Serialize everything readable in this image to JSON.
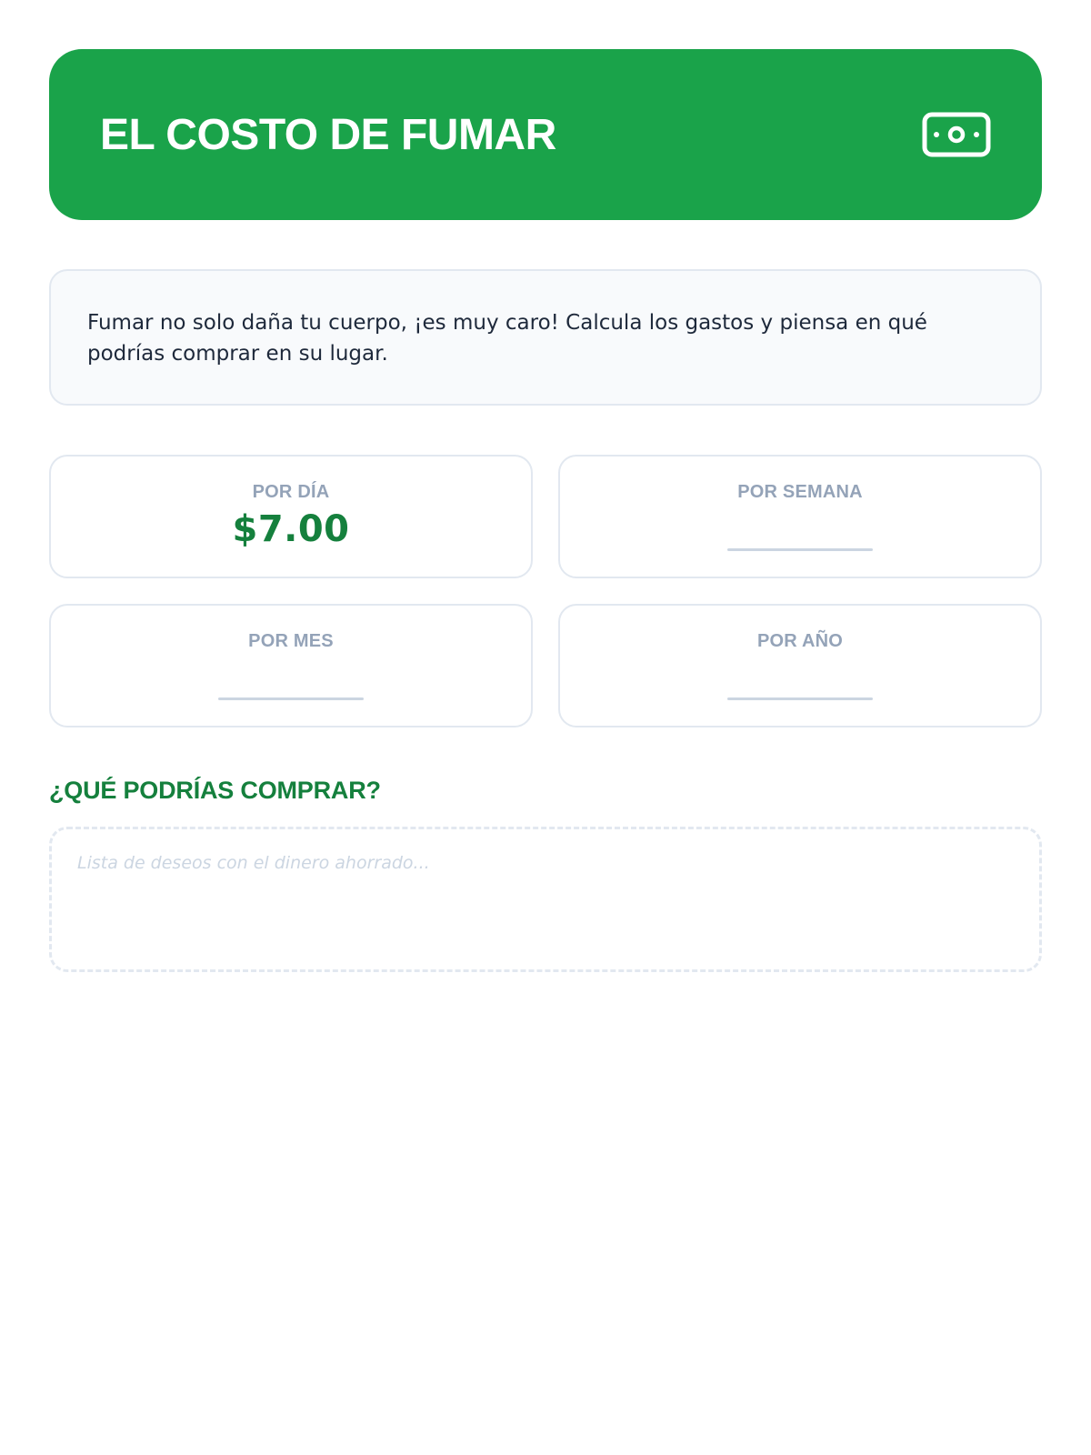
{
  "header": {
    "title": "EL COSTO DE FUMAR",
    "icon": "money-bill-icon",
    "color": "#1aa34a"
  },
  "intro": {
    "text": "Fumar no solo daña tu cuerpo, ¡es muy caro! Calcula los gastos y piensa en qué podrías comprar en su lugar."
  },
  "costs": {
    "day": {
      "label": "POR DÍA",
      "value": "$7.00"
    },
    "week": {
      "label": "POR SEMANA",
      "value": ""
    },
    "month": {
      "label": "POR MES",
      "value": ""
    },
    "year": {
      "label": "POR AÑO",
      "value": ""
    }
  },
  "wishlist": {
    "title": "¿QUÉ PODRÍAS COMPRAR?",
    "placeholder": "Lista de deseos con el dinero ahorrado...",
    "value": ""
  },
  "colors": {
    "accent": "#15803d",
    "label": "#94a3b8"
  }
}
